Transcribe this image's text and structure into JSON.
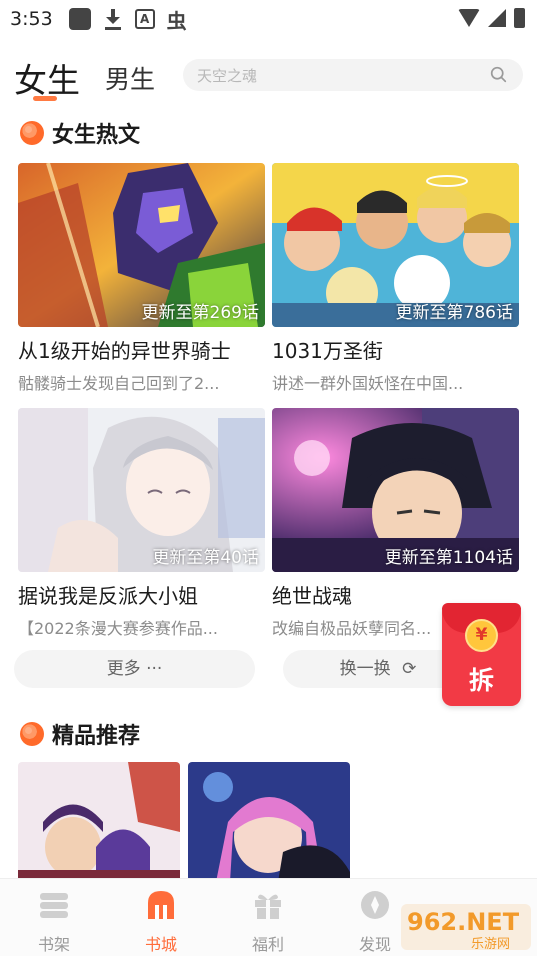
{
  "status_bar": {
    "time": "3:53"
  },
  "header": {
    "tab_active": "女生",
    "tab_inactive": "男生",
    "search_placeholder": "天空之魂"
  },
  "hot_section": {
    "title": "女生热文",
    "items": [
      {
        "title": "从1级开始的异世界骑士",
        "desc": "骷髅骑士发现自己回到了2...",
        "badge": "更新至第269话"
      },
      {
        "title": "1031万圣街",
        "desc": "讲述一群外国妖怪在中国...",
        "badge": "更新至第786话"
      },
      {
        "title": "据说我是反派大小姐",
        "desc": "【2022条漫大赛参赛作品...",
        "badge": "更新至第40话"
      },
      {
        "title": "绝世战魂",
        "desc": "改编自极品妖孽同名...",
        "badge": "更新至第1104话"
      }
    ],
    "more_label": "更多 ···",
    "refresh_label": "换一换"
  },
  "red_packet": {
    "coin": "¥",
    "label": "拆"
  },
  "recommend_section": {
    "title": "精品推荐"
  },
  "bottom_nav": {
    "items": [
      {
        "label": "书架"
      },
      {
        "label": "书城"
      },
      {
        "label": "福利"
      },
      {
        "label": "发现"
      }
    ]
  },
  "watermark": {
    "text": "962.NET",
    "sub": "乐游网"
  },
  "colors": {
    "accent": "#ff6c3a",
    "red_packet": "#f23a45"
  }
}
